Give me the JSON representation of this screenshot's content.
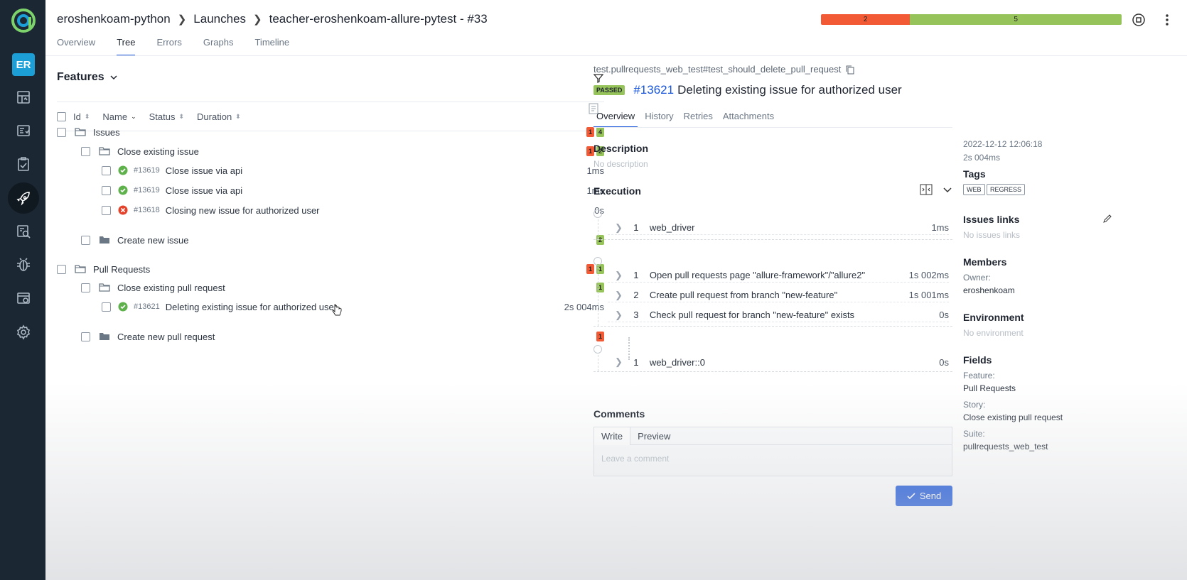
{
  "breadcrumb": [
    "eroshenkoam-python",
    "Launches",
    "teacher-eroshenkoam-allure-pytest - #33"
  ],
  "top_tabs": [
    {
      "label": "Overview",
      "active": false
    },
    {
      "label": "Tree",
      "active": true
    },
    {
      "label": "Errors",
      "active": false
    },
    {
      "label": "Graphs",
      "active": false
    },
    {
      "label": "Timeline",
      "active": false
    }
  ],
  "launch_status": {
    "failed": "2",
    "passed": "5",
    "colors": {
      "failed": "#f25a36",
      "passed": "#97c45a"
    }
  },
  "sidebar": {
    "avatar": "ER",
    "items": [
      "dashboards-icon",
      "test-cases-icon",
      "test-plans-icon",
      "launches-icon",
      "analytics-icon",
      "defects-icon",
      "jobs-icon",
      "settings-icon"
    ],
    "active": "launches-icon"
  },
  "tree": {
    "title": "Features",
    "columns": [
      "Id",
      "Name",
      "Status",
      "Duration"
    ],
    "rows": [
      {
        "level": 0,
        "type": "group",
        "name": "Issues",
        "failed": "1",
        "passed": "4"
      },
      {
        "level": 1,
        "type": "group",
        "name": "Close existing issue",
        "failed": "1",
        "passed": "2"
      },
      {
        "level": 2,
        "type": "test",
        "status": "passed",
        "id": "#13619",
        "name": "Close issue via api",
        "duration": "1ms"
      },
      {
        "level": 2,
        "type": "test",
        "status": "passed",
        "id": "#13619",
        "name": "Close issue via api",
        "duration": "1ms"
      },
      {
        "level": 2,
        "type": "test",
        "status": "failed",
        "id": "#13618",
        "name": "Closing new issue for authorized user",
        "duration": "0s"
      },
      {
        "level": 1,
        "type": "group",
        "name": "Create new issue",
        "failed": "",
        "passed": "2"
      },
      {
        "level": 0,
        "type": "group",
        "name": "Pull Requests",
        "failed": "1",
        "passed": "1"
      },
      {
        "level": 1,
        "type": "group",
        "name": "Close existing pull request",
        "failed": "",
        "passed": "1"
      },
      {
        "level": 2,
        "type": "test",
        "status": "passed",
        "id": "#13621",
        "name": "Deleting existing issue for authorized user",
        "duration": "2s 004ms"
      },
      {
        "level": 1,
        "type": "group",
        "name": "Create new pull request",
        "failed": "1",
        "passed": ""
      }
    ]
  },
  "detail": {
    "full_name": "test.pullrequests_web_test#test_should_delete_pull_request",
    "status": "PASSED",
    "id": "#13621",
    "title": "Deleting existing issue for authorized user",
    "tabs": [
      {
        "label": "Overview",
        "active": true
      },
      {
        "label": "History",
        "active": false
      },
      {
        "label": "Retries",
        "active": false
      },
      {
        "label": "Attachments",
        "active": false
      }
    ],
    "description_label": "Description",
    "description_value": "No description",
    "execution_label": "Execution",
    "setup_steps": [
      {
        "num": "1",
        "name": "web_driver",
        "duration": "1ms"
      }
    ],
    "test_steps": [
      {
        "num": "1",
        "name": "Open pull requests page \"allure-framework\"/\"allure2\"",
        "duration": "1s 002ms"
      },
      {
        "num": "2",
        "name": "Create pull request from branch \"new-feature\"",
        "duration": "1s 001ms"
      },
      {
        "num": "3",
        "name": "Check pull request for branch \"new-feature\" exists",
        "duration": "0s"
      }
    ],
    "teardown_steps": [
      {
        "num": "1",
        "name": "web_driver::0",
        "duration": "0s"
      }
    ],
    "comments_label": "Comments",
    "comment_tabs": [
      "Write",
      "Preview"
    ],
    "comment_placeholder": "Leave a comment",
    "send_label": "Send"
  },
  "meta": {
    "date": "2022-12-12 12:06:18",
    "duration": "2s 004ms",
    "tags_label": "Tags",
    "tags": [
      "WEB",
      "REGRESS"
    ],
    "issues_label": "Issues links",
    "issues_value": "No issues links",
    "members_label": "Members",
    "owner_label": "Owner:",
    "owner_value": "eroshenkoam",
    "environment_label": "Environment",
    "environment_value": "No environment",
    "fields_label": "Fields",
    "feature_label": "Feature:",
    "feature_value": "Pull Requests",
    "story_label": "Story:",
    "story_value": "Close existing pull request",
    "suite_label": "Suite:",
    "suite_value": "pullrequests_web_test"
  }
}
